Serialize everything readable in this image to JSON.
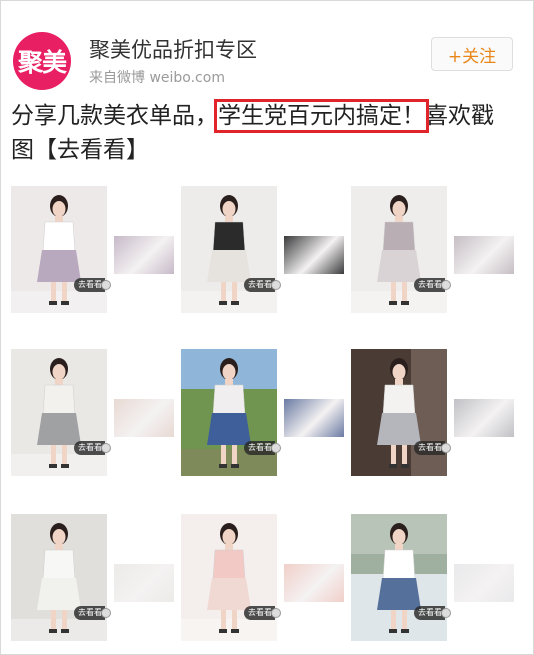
{
  "header": {
    "avatar_text": "聚美",
    "account_name": "聚美优品折扣专区",
    "source": "来自微博 weibo.com",
    "follow_label": "+关注"
  },
  "post": {
    "text_before": "分享几款美衣单品，",
    "text_highlight": "学生党百元内搞定！",
    "text_after": "喜欢戳图",
    "link_text": "【去看看】"
  },
  "grid": {
    "tag_label": "去看看",
    "items": [
      {
        "scene": "studio",
        "top": "#ffffff",
        "bottom": "#b8a9be",
        "detail": "#c7b9c8",
        "bg": "#ece9e8"
      },
      {
        "scene": "studio",
        "top": "#2b2b2b",
        "bottom": "#e6e3df",
        "detail": "#3a3a3c",
        "bg": "#eeecea"
      },
      {
        "scene": "studio",
        "top": "#b8aeb4",
        "bottom": "#d9d3d6",
        "detail": "#c5bec4",
        "bg": "#efedeb"
      },
      {
        "scene": "studio",
        "top": "#f2f1ee",
        "bottom": "#9fa1a3",
        "detail": "#e8d9d3",
        "bg": "#eae8e5"
      },
      {
        "scene": "outdoor",
        "top": "#f0eeee",
        "bottom": "#3e5f9a",
        "detail": "#6a7aa3",
        "bg": "#6f9550"
      },
      {
        "scene": "dark",
        "top": "#f4f2f0",
        "bottom": "#b5b6bc",
        "detail": "#c0c1c6",
        "bg": "#4b3b35"
      },
      {
        "scene": "studio",
        "top": "#f7f7f5",
        "bottom": "#f1f1ee",
        "detail": "#ecebe8",
        "bg": "#e0dfdc"
      },
      {
        "scene": "studio",
        "top": "#f2c9c4",
        "bottom": "#f0d9d3",
        "detail": "#f1cfc9",
        "bg": "#f4eeec"
      },
      {
        "scene": "street",
        "top": "#ffffff",
        "bottom": "#55709a",
        "detail": "#e9e9eb",
        "bg": "#b9c4b8"
      }
    ]
  }
}
